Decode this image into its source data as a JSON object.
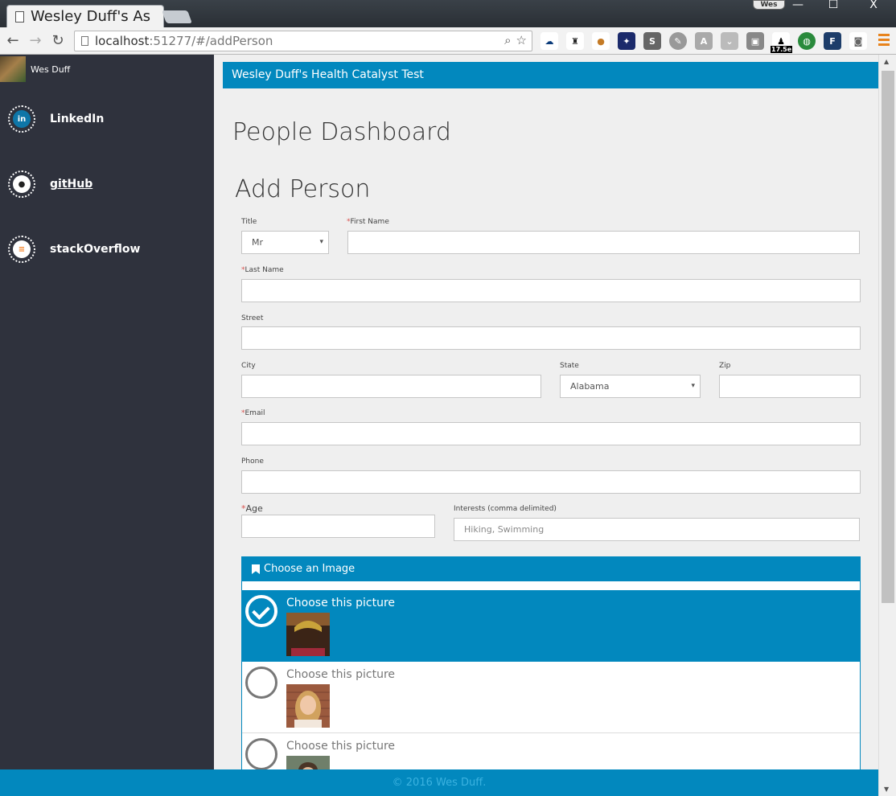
{
  "browser": {
    "tab_title": "Wesley Duff's As",
    "tab_close": "×",
    "profile_name": "Wes",
    "url_host": "localhost",
    "url_path": ":51277/#/addPerson",
    "extensions": [
      "onedrive-icon",
      "chef-icon",
      "cookie-icon",
      "nightsky-icon",
      "s-icon",
      "feather-icon",
      "angular-icon",
      "pocket-icon",
      "note-icon",
      "spy-icon",
      "globe-icon",
      "f-icon",
      "camera-icon"
    ],
    "ext_badge": "17.5e",
    "window_controls": {
      "minimize": "—",
      "maximize": "☐",
      "close": "X"
    }
  },
  "sidebar": {
    "username": "Wes Duff",
    "links": [
      {
        "label": "LinkedIn",
        "icon": "linkedin-icon",
        "glyph": "in"
      },
      {
        "label": "gitHub",
        "icon": "github-icon",
        "glyph": "●"
      },
      {
        "label": "stackOverflow",
        "icon": "stackoverflow-icon",
        "glyph": "≡"
      }
    ]
  },
  "header": {
    "brand": "Wesley Duff's Health Catalyst Test"
  },
  "page": {
    "title": "People Dashboard",
    "form_title": "Add Person"
  },
  "form": {
    "title_label": "Title",
    "title_value": "Mr",
    "first_name_label": "First Name",
    "last_name_label": "Last Name",
    "street_label": "Street",
    "city_label": "City",
    "state_label": "State",
    "state_value": "Alabama",
    "zip_label": "Zip",
    "email_label": "Email",
    "phone_label": "Phone",
    "age_label": "Age",
    "interests_label": "Interests (comma delimited)",
    "interests_placeholder": "Hiking, Swimming",
    "required_mark": "*"
  },
  "image_chooser": {
    "heading": "Choose an Image",
    "options": [
      {
        "label": "Choose this picture",
        "selected": true
      },
      {
        "label": "Choose this picture",
        "selected": false
      },
      {
        "label": "Choose this picture",
        "selected": false
      }
    ]
  },
  "footer": {
    "text": "© 2016 Wes Duff."
  },
  "colors": {
    "accent": "#0288be",
    "sidebar": "#2f323d",
    "required": "#d9534f"
  }
}
